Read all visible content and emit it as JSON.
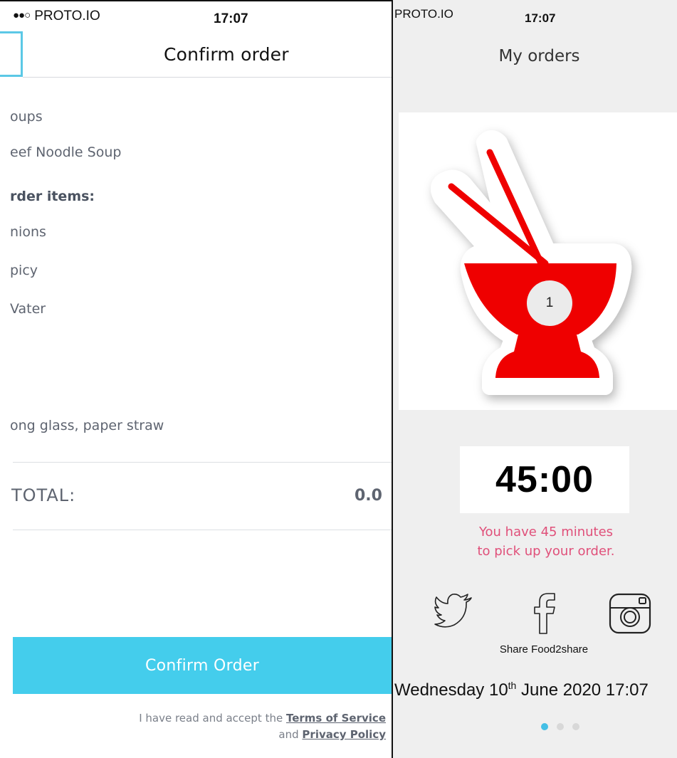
{
  "left_screen": {
    "status": {
      "signal": "●●○",
      "carrier": "PROTO.IO",
      "time": "17:07"
    },
    "title": "Confirm order",
    "category": "oups",
    "dish": "eef Noodle Soup",
    "order_items_label": "rder items:",
    "items": [
      "nions",
      "picy",
      "Vater"
    ],
    "extra": "ong glass, paper straw",
    "total_label": "TOTAL:",
    "total_value": "0.0",
    "confirm_button": "Confirm Order",
    "terms": {
      "prefix": "I have read and accept the",
      "tos": "Terms of Service",
      "and": "and",
      "privacy": "Privacy Policy"
    }
  },
  "right_screen": {
    "status": {
      "carrier": "PROTO.IO",
      "time": "17:07"
    },
    "title": "My orders",
    "badge": "1",
    "timer": "45:00",
    "pickup_line1": "You have 45 minutes",
    "pickup_line2": "to pick up your order.",
    "share_label": "Share Food2share",
    "date_weekday": "Wednesday 10",
    "date_suffix": "th",
    "date_rest": "June 2020 17:07",
    "pager": {
      "count": 3,
      "active": 0
    },
    "colors": {
      "bowl": "#ef0000",
      "accent": "#44cdec",
      "pickup_text": "#e0507a"
    },
    "icons": [
      "twitter-icon",
      "facebook-icon",
      "instagram-icon"
    ]
  }
}
